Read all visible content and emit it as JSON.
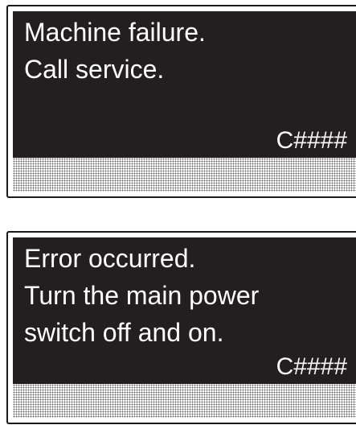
{
  "panels": [
    {
      "lines": [
        "Machine failure.",
        "Call service."
      ],
      "code": "C####"
    },
    {
      "lines": [
        "Error occurred.",
        "Turn the main power",
        "switch off and on."
      ],
      "code": "C####"
    }
  ]
}
